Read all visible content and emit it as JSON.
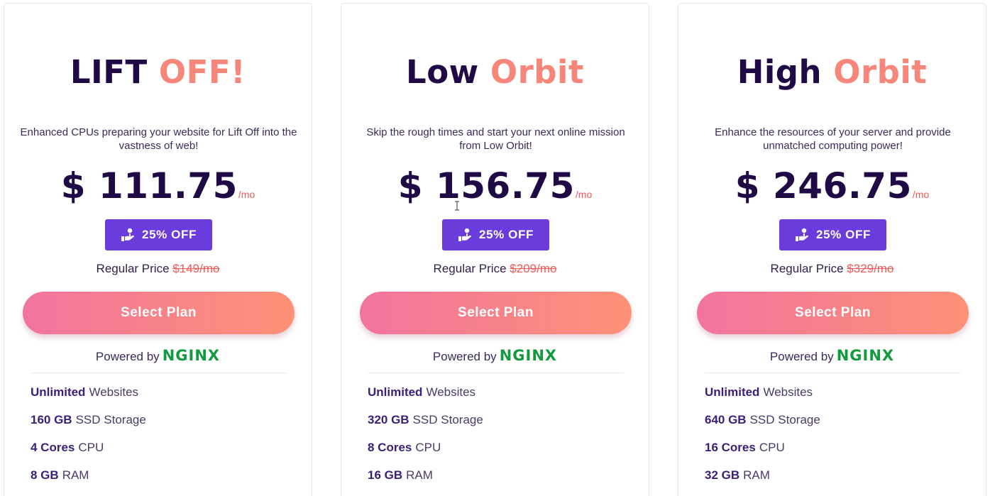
{
  "plans": [
    {
      "title_main": "LIFT",
      "title_accent": "OFF!",
      "description": "Enhanced CPUs preparing your website for Lift Off into the vastness of web!",
      "price": "$ 111.75",
      "per": "/mo",
      "discount_label": "25% OFF",
      "regular_label": "Regular Price",
      "regular_price": "$149/mo",
      "select_label": "Select Plan",
      "powered_label": "Powered by",
      "powered_brand": "NGINX",
      "features": [
        {
          "strong": "Unlimited",
          "rest": "Websites"
        },
        {
          "strong": "160 GB",
          "rest": "SSD Storage"
        },
        {
          "strong": "4 Cores",
          "rest": "CPU"
        },
        {
          "strong": "8 GB",
          "rest": "RAM"
        }
      ]
    },
    {
      "title_main": "Low",
      "title_accent": "Orbit",
      "description": "Skip the rough times and start your next online mission from Low Orbit!",
      "price": "$ 156.75",
      "per": "/mo",
      "discount_label": "25% OFF",
      "regular_label": "Regular Price",
      "regular_price": "$209/mo",
      "select_label": "Select Plan",
      "powered_label": "Powered by",
      "powered_brand": "NGINX",
      "features": [
        {
          "strong": "Unlimited",
          "rest": "Websites"
        },
        {
          "strong": "320 GB",
          "rest": "SSD Storage"
        },
        {
          "strong": "8 Cores",
          "rest": "CPU"
        },
        {
          "strong": "16 GB",
          "rest": "RAM"
        }
      ]
    },
    {
      "title_main": "High",
      "title_accent": "Orbit",
      "description": "Enhance the resources of your server and provide unmatched computing power!",
      "price": "$ 246.75",
      "per": "/mo",
      "discount_label": "25% OFF",
      "regular_label": "Regular Price",
      "regular_price": "$329/mo",
      "select_label": "Select Plan",
      "powered_label": "Powered by",
      "powered_brand": "NGINX",
      "features": [
        {
          "strong": "Unlimited",
          "rest": "Websites"
        },
        {
          "strong": "640 GB",
          "rest": "SSD Storage"
        },
        {
          "strong": "16 Cores",
          "rest": "CPU"
        },
        {
          "strong": "32 GB",
          "rest": "RAM"
        }
      ]
    }
  ],
  "icons": {
    "discount": "hand-coin-icon",
    "cursor": "text-cursor-icon"
  },
  "colors": {
    "title": "#200a45",
    "accent": "#f7867a",
    "discount_bg": "#6a3cdc",
    "button_gradient_start": "#f2749e",
    "button_gradient_end": "#fe9176",
    "strike_price": "#f05a5a",
    "nginx_green": "#119a3e"
  }
}
